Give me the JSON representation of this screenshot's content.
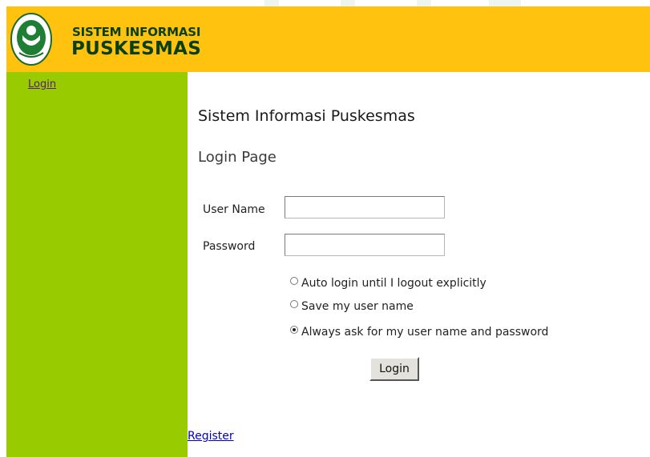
{
  "header": {
    "brand_line1": "SISTEM INFORMASI",
    "brand_line2": "PUSKESMAS",
    "bg_color": "#ffc20e",
    "logo_icon": "kemenkes-logo-icon"
  },
  "sidebar": {
    "bg_color": "#99cc00",
    "login_link": "Login"
  },
  "main": {
    "site_title": "Sistem Informasi Puskesmas",
    "page_title": "Login Page",
    "username_label": "User Name",
    "username_value": "",
    "password_label": "Password",
    "password_value": "",
    "options": [
      {
        "label": "Auto login until I logout explicitly",
        "checked": false
      },
      {
        "label": "Save my user name",
        "checked": false
      },
      {
        "label": "Always ask for my user name and password",
        "checked": true
      }
    ],
    "login_button": "Login",
    "register_link": "Register"
  }
}
